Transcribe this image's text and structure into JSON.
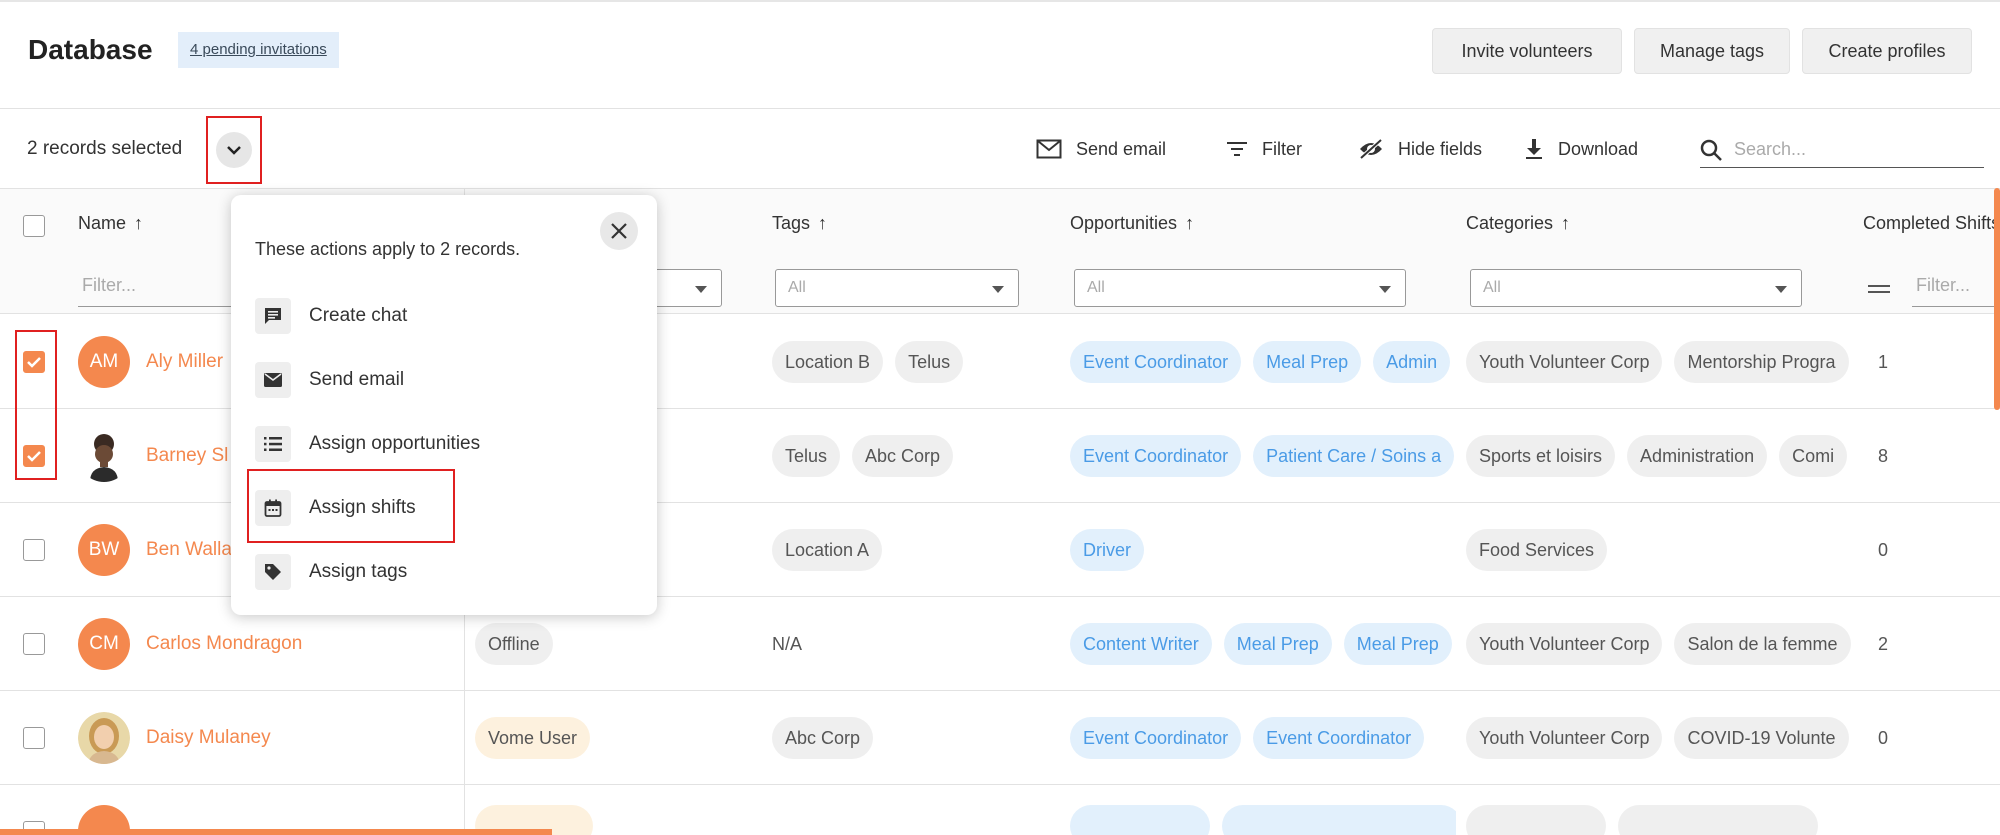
{
  "header": {
    "title": "Database",
    "pending_badge": "4 pending invitations",
    "buttons": {
      "invite": "Invite volunteers",
      "manage_tags": "Manage tags",
      "create_profiles": "Create profiles"
    }
  },
  "toolbar": {
    "selection_text": "2 records selected",
    "send_email": "Send email",
    "filter": "Filter",
    "hide_fields": "Hide fields",
    "download": "Download",
    "search_placeholder": "Search..."
  },
  "table": {
    "columns": {
      "name": "Name",
      "tags": "Tags",
      "opportunities": "Opportunities",
      "categories": "Categories",
      "completed_shifts": "Completed Shifts"
    },
    "filters": {
      "name_placeholder": "Filter...",
      "all": "All",
      "completed_placeholder": "Filter..."
    },
    "rows": [
      {
        "initials": "AM",
        "name": "Aly Miller",
        "checked": true,
        "status": "",
        "tags": [
          "Location B",
          "Telus"
        ],
        "opportunities": [
          "Event Coordinator",
          "Meal Prep",
          "Admin"
        ],
        "categories": [
          "Youth Volunteer Corp",
          "Mentorship Progra"
        ],
        "completed": "1"
      },
      {
        "initials": "",
        "name": "Barney Sl",
        "checked": true,
        "status": "",
        "tags": [
          "Telus",
          "Abc Corp"
        ],
        "opportunities": [
          "Event Coordinator",
          "Patient Care / Soins a"
        ],
        "categories": [
          "Sports et loisirs",
          "Administration",
          "Comi"
        ],
        "completed": "8"
      },
      {
        "initials": "BW",
        "name": "Ben Walla",
        "checked": false,
        "status": "",
        "tags": [
          "Location A"
        ],
        "opportunities": [
          "Driver"
        ],
        "categories": [
          "Food Services"
        ],
        "completed": "0"
      },
      {
        "initials": "CM",
        "name": "Carlos Mondragon",
        "checked": false,
        "status": "Offline",
        "tags_text": "N/A",
        "opportunities": [
          "Content Writer",
          "Meal Prep",
          "Meal Prep"
        ],
        "categories": [
          "Youth Volunteer Corp",
          "Salon de la femme"
        ],
        "completed": "2"
      },
      {
        "initials": "",
        "name": "Daisy Mulaney",
        "checked": false,
        "status": "Vome User",
        "tags": [
          "Abc Corp"
        ],
        "opportunities": [
          "Event Coordinator",
          "Event Coordinator"
        ],
        "categories": [
          "Youth Volunteer Corp",
          "COVID-19 Volunte"
        ],
        "completed": "0"
      }
    ]
  },
  "popup": {
    "title": "These actions apply to 2 records.",
    "items": {
      "create_chat": "Create chat",
      "send_email": "Send email",
      "assign_opportunities": "Assign opportunities",
      "assign_shifts": "Assign shifts",
      "assign_tags": "Assign tags"
    }
  },
  "colors": {
    "accent": "#f4884e",
    "chip_blue_text": "#4a9be6",
    "chip_blue_bg": "#e2f0fc",
    "highlight_red": "#e02020"
  }
}
